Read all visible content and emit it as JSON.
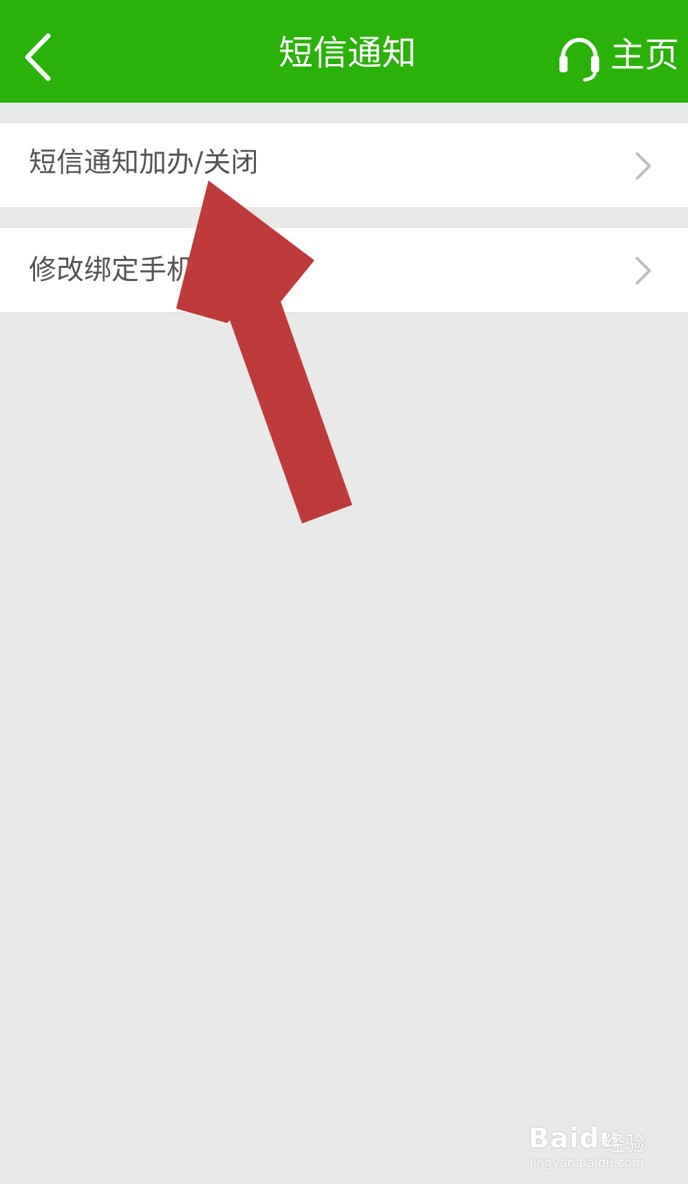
{
  "header": {
    "title": "短信通知",
    "home_label": "主页",
    "background_color": "#2bb20a",
    "back_icon": "chevron-left-icon",
    "home_icon": "headset-icon"
  },
  "menu": {
    "items": [
      {
        "label": "短信通知加办/关闭",
        "icon": "chevron-right-icon"
      },
      {
        "label": "修改绑定手机",
        "icon": "chevron-right-icon"
      }
    ]
  },
  "annotation": {
    "arrow_color": "#bf3a3b"
  },
  "watermark": {
    "logo_text": "Baidu",
    "cn_text": "经验",
    "url": "jingyan.baidu.com"
  }
}
